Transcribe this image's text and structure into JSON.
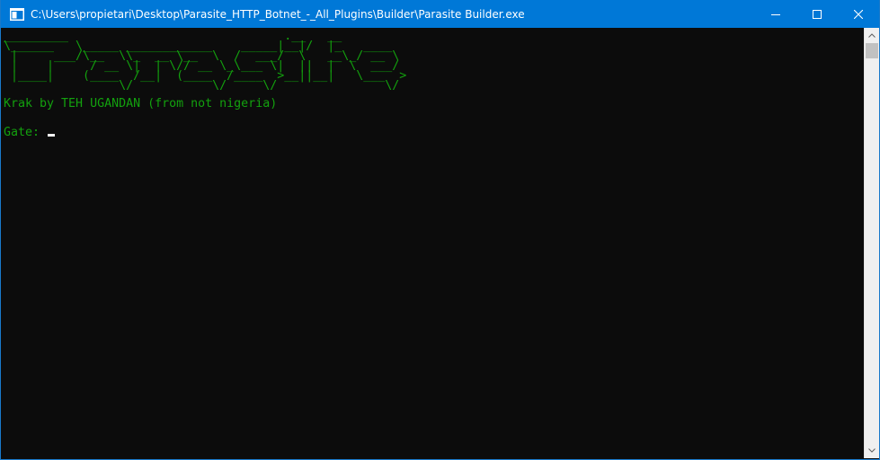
{
  "window": {
    "title": "C:\\Users\\propietari\\Desktop\\Parasite_HTTP_Botnet_-_All_Plugins\\Builder\\Parasite Builder.exe",
    "icon": "console-window-icon",
    "controls": {
      "minimize_icon": "minimize-icon",
      "maximize_icon": "maximize-icon",
      "close_icon": "close-icon"
    }
  },
  "console": {
    "ascii_banner": "_________                              .__   __\n\\______   \\_____ ____________    _____|__|/  |_   ____\n |     ___/\\__  \\\\_  __ \\__  \\  /  ___/  \\   __\\_/ __ \\\n |    |     / __ \\|  | \\// __ \\_\\___ \\|  ||  |  \\  ___/\n |____|    (____  /__|  (____  /____  >__||__|   \\___  >\n                \\/           \\/     \\/               \\/",
    "credit_line": "Krak by TEH UGANDAN (from not nigeria)",
    "blank_line": "",
    "prompt_label": "Gate: ",
    "input_value": ""
  },
  "colors": {
    "console_background": "#0c0c0c",
    "console_text": "#13a10e",
    "titlebar": "#0078d7",
    "cursor": "#f2f2f2"
  },
  "scrollbar": {
    "up_icon": "scroll-up-arrow-icon",
    "down_icon": "scroll-down-arrow-icon"
  }
}
